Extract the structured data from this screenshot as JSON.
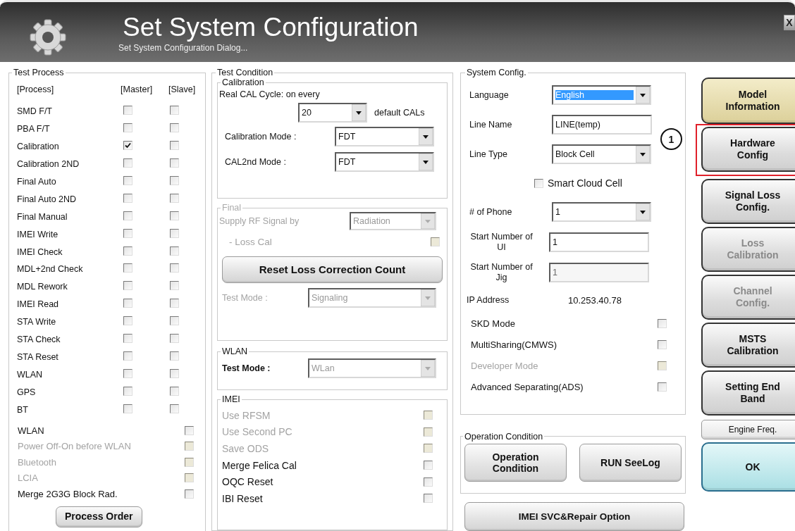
{
  "window": {
    "title": "Set System Configuration",
    "subtitle": "Set System Configuration Dialog...",
    "close": "X"
  },
  "test_process": {
    "title": "Test Process",
    "headers": [
      "[Process]",
      "[Master]",
      "[Slave]"
    ],
    "rows": [
      {
        "label": "SMD F/T",
        "master": false,
        "slave": false
      },
      {
        "label": "PBA F/T",
        "master": false,
        "slave": false
      },
      {
        "label": "Calibration",
        "master": true,
        "slave": false
      },
      {
        "label": "Calibration 2ND",
        "master": false,
        "slave": false
      },
      {
        "label": "Final Auto",
        "master": false,
        "slave": false
      },
      {
        "label": "Final Auto 2ND",
        "master": false,
        "slave": false
      },
      {
        "label": "Final Manual",
        "master": false,
        "slave": false
      },
      {
        "label": "IMEI Write",
        "master": false,
        "slave": false
      },
      {
        "label": "IMEI Check",
        "master": false,
        "slave": false
      },
      {
        "label": "MDL+2nd Check",
        "master": false,
        "slave": false
      },
      {
        "label": "MDL Rework",
        "master": false,
        "slave": false
      },
      {
        "label": "IMEI Read",
        "master": false,
        "slave": false
      },
      {
        "label": "STA Write",
        "master": false,
        "slave": false
      },
      {
        "label": "STA Check",
        "master": false,
        "slave": false
      },
      {
        "label": "STA Reset",
        "master": false,
        "slave": false
      },
      {
        "label": "WLAN",
        "master": false,
        "slave": false
      },
      {
        "label": "GPS",
        "master": false,
        "slave": false
      },
      {
        "label": "BT",
        "master": false,
        "slave": false
      }
    ],
    "options": [
      {
        "label": "WLAN",
        "checked": false,
        "disabled": false
      },
      {
        "label": "Power Off-On before WLAN",
        "checked": false,
        "disabled": true
      },
      {
        "label": "Bluetooth",
        "checked": false,
        "disabled": true
      },
      {
        "label": "LCIA",
        "checked": false,
        "disabled": true
      },
      {
        "label": "Merge 2G3G Block Rad.",
        "checked": false,
        "disabled": false
      }
    ],
    "button": "Process Order"
  },
  "test_condition": {
    "title": "Test Condition",
    "calibration": {
      "title": "Calibration",
      "cycle_label": "Real CAL Cycle: on every",
      "cycle_value": "20",
      "cycle_suffix": "default CALs",
      "modes": [
        {
          "label": "Calibration Mode :",
          "value": "FDT"
        },
        {
          "label": "CAL2nd Mode :",
          "value": "FDT"
        }
      ]
    },
    "final": {
      "title": "Final",
      "disabled": true,
      "supply_label": "Supply RF Signal by",
      "supply_value": "Radiation",
      "loss_cal_label": "- Loss Cal",
      "loss_cal_checked": false,
      "reset_button": "Reset Loss Correction Count",
      "test_mode_label": "Test Mode :",
      "test_mode_value": "Signaling"
    },
    "wlan": {
      "title": "WLAN",
      "disabled": true,
      "test_mode_label": "Test Mode :",
      "test_mode_value": "WLan"
    },
    "imei": {
      "title": "IMEI",
      "options": [
        {
          "label": "Use RFSM",
          "checked": false,
          "disabled": true
        },
        {
          "label": "Use Second PC",
          "checked": false,
          "disabled": true
        },
        {
          "label": "Save ODS",
          "checked": false,
          "disabled": true
        },
        {
          "label": "Merge Felica Cal",
          "checked": false,
          "disabled": false
        },
        {
          "label": "OQC Reset",
          "checked": false,
          "disabled": false
        },
        {
          "label": "IBI Reset",
          "checked": false,
          "disabled": false
        }
      ]
    }
  },
  "system_config": {
    "title": "System Config.",
    "fields": [
      {
        "kind": "select",
        "label": "Language",
        "value": "English",
        "highlighted": true,
        "disabled": false
      },
      {
        "kind": "text",
        "label": "Line Name",
        "value": "LINE(temp)",
        "highlighted": false,
        "disabled": false
      },
      {
        "kind": "select",
        "label": "Line Type",
        "value": "Block Cell",
        "highlighted": false,
        "disabled": false
      },
      {
        "kind": "checkbox",
        "label": "Smart Cloud Cell",
        "checked": false
      },
      {
        "kind": "select",
        "label": "# of Phone",
        "value": "1",
        "highlighted": false,
        "disabled": false
      },
      {
        "kind": "text",
        "label": "Start Number of UI",
        "value": "1",
        "highlighted": false,
        "disabled": false
      },
      {
        "kind": "text",
        "label": "Start Number of Jig",
        "value": "1",
        "highlighted": false,
        "disabled": true
      },
      {
        "kind": "info",
        "label": "IP Address",
        "value": "10.253.40.78"
      }
    ],
    "options": [
      {
        "label": "SKD Mode",
        "checked": false,
        "disabled": false
      },
      {
        "label": "MultiSharing(CMWS)",
        "checked": false,
        "disabled": false
      },
      {
        "label": "Developer Mode",
        "checked": false,
        "disabled": true
      },
      {
        "label": "Advanced Separating(ADS)",
        "checked": false,
        "disabled": false
      }
    ]
  },
  "operation_condition": {
    "title": "Operation Condition",
    "buttons": [
      "Operation Condition",
      "RUN SeeLog"
    ]
  },
  "imei_button": "IMEI SVC&Repair Option",
  "side_buttons": [
    {
      "label": "Model Information",
      "kind": "gold",
      "disabled": false,
      "highlighted": false
    },
    {
      "label": "Hardware Config",
      "kind": "plain",
      "disabled": false,
      "highlighted": true,
      "callout": "1"
    },
    {
      "label": "Signal Loss Config.",
      "kind": "plain",
      "disabled": false,
      "highlighted": false
    },
    {
      "label": "Loss Calibration",
      "kind": "plain",
      "disabled": true,
      "highlighted": false
    },
    {
      "label": "Channel Config.",
      "kind": "plain",
      "disabled": true,
      "highlighted": false
    },
    {
      "label": "MSTS Calibration",
      "kind": "plain",
      "disabled": false,
      "highlighted": false
    },
    {
      "label": "Setting End Band",
      "kind": "plain",
      "disabled": false,
      "highlighted": false
    },
    {
      "label": "Engine Freq.",
      "kind": "compact",
      "disabled": false,
      "highlighted": false
    },
    {
      "label": "OK",
      "kind": "confirm",
      "disabled": false,
      "highlighted": false
    }
  ]
}
